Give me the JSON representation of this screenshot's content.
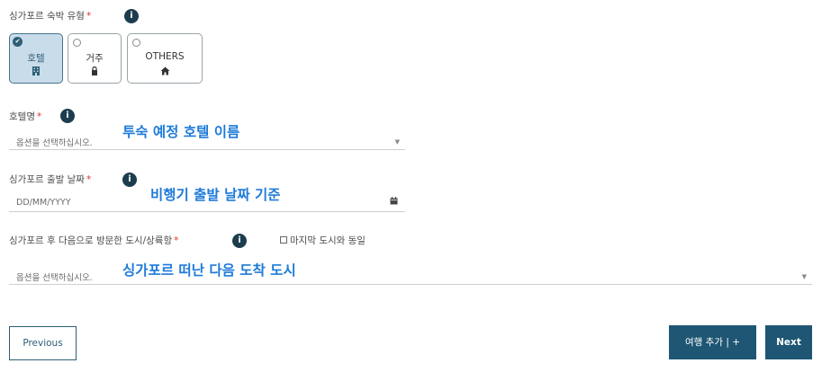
{
  "accommodation": {
    "label": "싱가포르 숙박 유형",
    "required_mark": "*",
    "info_icon": "i",
    "options": [
      {
        "label": "호텔",
        "icon": "hotel-icon",
        "selected": true
      },
      {
        "label": "거주",
        "icon": "lock-icon",
        "selected": false
      },
      {
        "label": "OTHERS",
        "icon": "home-icon",
        "selected": false
      }
    ]
  },
  "hotel": {
    "label": "호텔명",
    "required_mark": "*",
    "placeholder": "옵션을 선택하십시오.",
    "annotation": "투숙 예정 호텔 이름"
  },
  "departure_date": {
    "label": "싱가포르 출발 날짜",
    "required_mark": "*",
    "placeholder": "DD/MM/YYYY",
    "annotation": "비행기 출발 날짜 기준"
  },
  "next_city": {
    "label": "싱가포르 후 다음으로 방문한 도시/상륙항",
    "required_mark": "*",
    "checkbox_label": "마지막 도시와 동일",
    "placeholder": "옵션을 선택하십시오.",
    "annotation": "싱가포르 떠난 다음 도착 도시"
  },
  "buttons": {
    "previous": "Previous",
    "add_trip": "여행 추가 | +",
    "next": "Next"
  },
  "colors": {
    "primary": "#1e5673",
    "selected_bg": "#c9dce9",
    "annotation": "#1f7bd9",
    "required": "#e0322d"
  }
}
